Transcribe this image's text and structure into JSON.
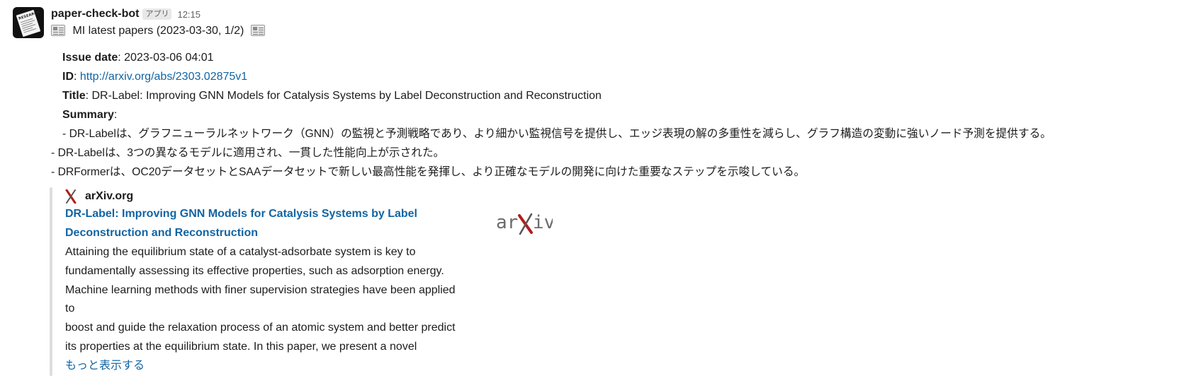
{
  "message": {
    "bot_name": "paper-check-bot",
    "app_badge": "アプリ",
    "timestamp": "12:15",
    "avatar_text": "RESEARCH",
    "heading": "MI latest papers (2023-03-30, 1/2)",
    "heading_icon": "newspaper-icon",
    "fields": {
      "issue_date_label": "Issue date",
      "issue_date_value": ": 2023-03-06 04:01",
      "id_label": "ID",
      "id_sep": ": ",
      "id_value": "http://arxiv.org/abs/2303.02875v1",
      "title_label": "Title",
      "title_value": ": DR-Label: Improving GNN Models for Catalysis Systems by Label Deconstruction and Reconstruction",
      "summary_label": "Summary",
      "summary_sep": ":"
    },
    "summary_lines": [
      "- DR-Labelは、グラフニューラルネットワーク（GNN）の監視と予測戦略であり、より細かい監視信号を提供し、エッジ表現の解の多重性を減らし、グラフ構造の変動に強いノード予測を提供する。",
      "- DR-Labelは、3つの異なるモデルに適用され、一貫した性能向上が示された。",
      "- DRFormerは、OC20データセットとSAAデータセットで新しい最高性能を発揮し、より正確なモデルの開発に向けた重要なステップを示唆している。"
    ]
  },
  "attachment": {
    "site_name": "arXiv.org",
    "site_icon": "arxiv-x-icon",
    "title_lines": [
      "DR-Label: Improving GNN Models for Catalysis Systems by Label",
      "Deconstruction and Reconstruction"
    ],
    "abstract_lines": [
      "Attaining the equilibrium state of a catalyst-adsorbate system is key to",
      "fundamentally assessing its effective properties, such as adsorption energy.",
      "Machine learning methods with finer supervision strategies have been applied",
      "to",
      "boost and guide the relaxation process of an atomic system and better predict",
      "its properties at the equilibrium state. In this paper, we present a novel"
    ],
    "show_more": "もっと表示する",
    "thumbnail_text_left": "ar",
    "thumbnail_text_right": "iv",
    "accent_red": "#b31b1b"
  }
}
